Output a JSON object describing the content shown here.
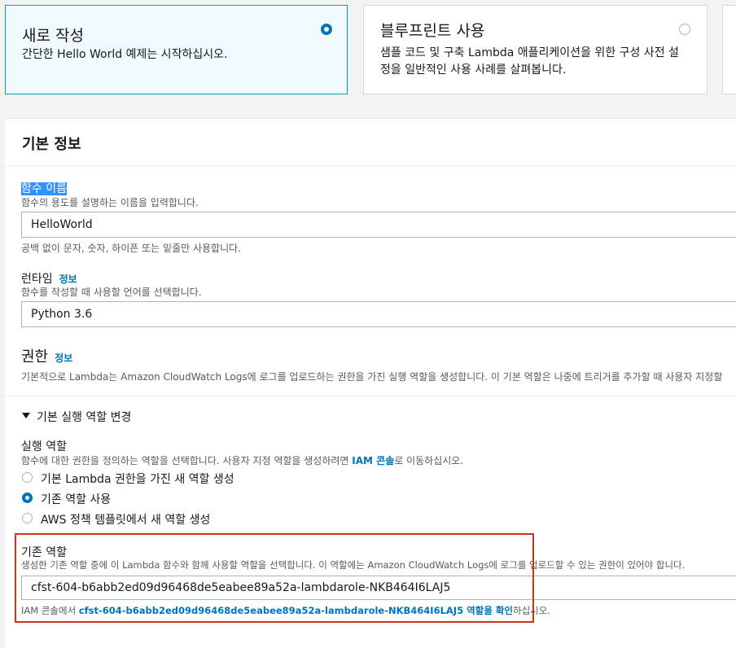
{
  "options": {
    "new": {
      "title": "새로 작성",
      "desc": "간단한 Hello World 예제는 시작하십시오."
    },
    "blueprint": {
      "title": "블루프린트 사용",
      "desc_line1": "샘플 코드 및 구축 Lambda 애플리케이션을 위한 구성 사전 설",
      "desc_line2": "정을 일반적인 사용 사례를 살펴봅니다."
    }
  },
  "section": {
    "title": "기본 정보"
  },
  "function_name": {
    "label": "함수 이름",
    "desc": "함수의 용도를 설명하는 이름을 입력합니다.",
    "value": "HelloWorld",
    "hint": "공백 없이 문자, 숫자, 하이픈 또는 밑줄만 사용합니다."
  },
  "runtime": {
    "label": "런타임",
    "info": "정보",
    "desc": "함수를 작성할 때 사용할 언어를 선택합니다.",
    "value": "Python 3.6"
  },
  "permissions": {
    "label": "권한",
    "info": "정보",
    "desc": "기본적으로 Lambda는 Amazon CloudWatch Logs에 로그를 업로드하는 권한을 가진 실행 역할을 생성합니다. 이 기본 역할은 나중에 트리거를 추가할 때 사용자 지정할"
  },
  "role_change": {
    "label": "기본 실행 역할 변경"
  },
  "execution_role": {
    "label": "실행 역할",
    "desc_prefix": "함수에 대한 권한을 정의하는 역할을 선택합니다. 사용자 지정 역할을 생성하려면 ",
    "desc_link": "IAM 콘솔",
    "desc_suffix": "로 이동하십시오.",
    "options": [
      "기본 Lambda 권한을 가진 새 역할 생성",
      "기존 역할 사용",
      "AWS 정책 템플릿에서 새 역할 생성"
    ]
  },
  "existing_role": {
    "label": "기존 역할",
    "desc": "생성한 기존 역할 중에 이 Lambda 함수와 함께 사용할 역할을 선택합니다. 이 역할에는 Amazon CloudWatch Logs에 로그를 업로드할 수 있는 권한이 있어야 합니다.",
    "value": "cfst-604-b6abb2ed09d96468de5eabee89a52a-lambdarole-NKB464I6LAJ5",
    "footer_prefix": "IAM 콘솔에서 ",
    "footer_link": "cfst-604-b6abb2ed09d96468de5eabee89a52a-lambdarole-NKB464I6LAJ5 역할을 확인",
    "footer_suffix": "하십시오."
  }
}
